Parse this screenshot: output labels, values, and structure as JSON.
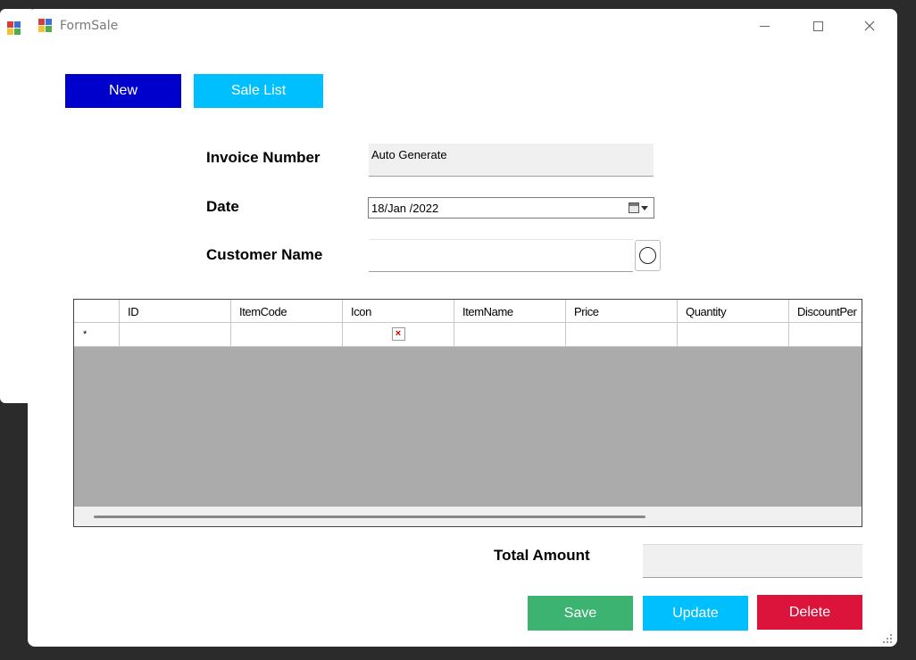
{
  "window": {
    "title": "FormSale"
  },
  "toolbar": {
    "new_label": "New",
    "sale_list_label": "Sale List"
  },
  "form": {
    "invoice_number_label": "Invoice Number",
    "invoice_number_value": "Auto Generate",
    "date_label": "Date",
    "date_value": "18/Jan /2022",
    "customer_name_label": "Customer Name",
    "customer_name_value": ""
  },
  "grid": {
    "columns": [
      "ID",
      "ItemCode",
      "Icon",
      "ItemName",
      "Price",
      "Quantity",
      "DiscountPer"
    ],
    "new_row_marker": "*",
    "broken_image_glyph": "×"
  },
  "totals": {
    "total_amount_label": "Total Amount",
    "total_amount_value": ""
  },
  "actions": {
    "save_label": "Save",
    "update_label": "Update",
    "delete_label": "Delete"
  },
  "colors": {
    "new_button": "#0000cd",
    "sale_list_button": "#00bfff",
    "save_button": "#3cb371",
    "update_button": "#00bfff",
    "delete_button": "#dc143c",
    "grid_background": "#ababab"
  },
  "icons": {
    "app": "app-form-icon",
    "minimize": "minimize-icon",
    "maximize": "maximize-icon",
    "close": "close-icon",
    "calendar": "calendar-dropdown-icon",
    "customer_search": "circle-search-icon",
    "broken_image": "broken-image-icon"
  }
}
